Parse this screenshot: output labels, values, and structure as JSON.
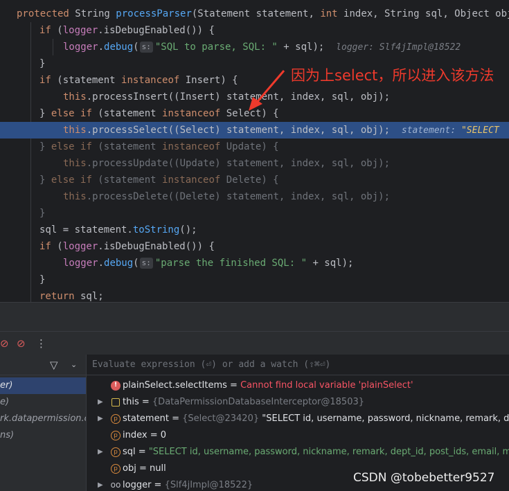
{
  "editor": {
    "line_signature": {
      "kw_protected": "protected",
      "type_string": " String ",
      "method_name": "processParser",
      "params": "(Statement statement, ",
      "kw_int": "int",
      "params_rest": " index, String sql, Object obj"
    },
    "line_if_debug": {
      "kw_if": "if",
      "open": " (",
      "field": "logger",
      "call": ".isDebugEnabled()) {"
    },
    "line_debug1": {
      "field": "logger",
      "dot": ".",
      "call": "debug",
      "open": "(",
      "chip": "s:",
      "string": "\"SQL to parse, SQL: \"",
      "rest": " + sql);",
      "hint": "logger: Slf4jImpl@18522"
    },
    "line_close1": "}",
    "line_if_insert": {
      "kw_if": "if",
      "open": " (statement ",
      "kw_instanceof": "instanceof",
      "rest": " Insert) {"
    },
    "line_process_insert": {
      "kw_this": "this",
      "call": ".processInsert((Insert) statement, index, sql, obj);"
    },
    "line_else_select": {
      "close": "} ",
      "kw_else": "else",
      "sp": " ",
      "kw_if": "if",
      "open": " (statement ",
      "kw_instanceof": "instanceof",
      "rest": " Select) {"
    },
    "line_process_select": {
      "kw_this": "this",
      "call": ".processSelect((Select) statement, index, sql, obj);",
      "hint_name": "statement: ",
      "hint_value": "\"SELECT"
    },
    "line_else_update": {
      "close": "} ",
      "kw_else": "else",
      "sp": " ",
      "kw_if": "if",
      "open": " (statement ",
      "kw_instanceof": "instanceof",
      "rest": " Update) {"
    },
    "line_process_update": {
      "kw_this": "this",
      "call": ".processUpdate((Update) statement, index, sql, obj);"
    },
    "line_else_delete": {
      "close": "} ",
      "kw_else": "else",
      "sp": " ",
      "kw_if": "if",
      "open": " (statement ",
      "kw_instanceof": "instanceof",
      "rest": " Delete) {"
    },
    "line_process_delete": {
      "kw_this": "this",
      "call": ".processDelete((Delete) statement, index, sql, obj);"
    },
    "line_close2": "}",
    "line_sql_assign": {
      "left": "sql = statement.",
      "call": "toString",
      "rest": "();"
    },
    "line_if_debug2": {
      "kw_if": "if",
      "open": " (",
      "field": "logger",
      "call": ".isDebugEnabled()) {"
    },
    "line_debug2": {
      "field": "logger",
      "dot": ".",
      "call": "debug",
      "open": "(",
      "chip": "s:",
      "string": "\"parse the finished SQL: \"",
      "rest": " + sql);"
    },
    "line_close3": "}",
    "line_return": {
      "kw_return": "return",
      "rest": " sql;"
    }
  },
  "annotation": {
    "text": "因为上select，所以进入该方法",
    "color": "#ef3a2c"
  },
  "debugger": {
    "evaluate_placeholder": "Evaluate expression (⏎) or add a watch (⇧⌘⏎)",
    "frames": [
      {
        "label": "er)",
        "selected": true
      },
      {
        "label": "e)",
        "selected": false
      },
      {
        "label": "rk.datapermission.co",
        "selected": false
      },
      {
        "label": "ns)",
        "selected": false
      }
    ],
    "variables": [
      {
        "icon": "error-icon",
        "expandable": false,
        "name": "plainSelect.selectItems",
        "eq": " = ",
        "type": "",
        "value": "Cannot find local variable 'plainSelect'",
        "value_kind": "error"
      },
      {
        "icon": "field-icon",
        "expandable": true,
        "name": "this",
        "eq": " = ",
        "type": "{DataPermissionDatabaseInterceptor@18503}",
        "value": "",
        "value_kind": "plain"
      },
      {
        "icon": "parameter-icon",
        "expandable": true,
        "name": "statement",
        "eq": " = ",
        "type": "{Select@23420}",
        "value": " \"SELECT id, username, password, nickname, remark, dept_id, p",
        "value_kind": "plain"
      },
      {
        "icon": "parameter-icon",
        "expandable": false,
        "name": "index",
        "eq": " = ",
        "type": "",
        "value": "0",
        "value_kind": "plain"
      },
      {
        "icon": "parameter-icon",
        "expandable": true,
        "name": "sql",
        "eq": " = ",
        "type": "",
        "value": "\"SELECT id, username, password, nickname, remark, dept_id, post_ids, email, mobile, s",
        "value_kind": "string"
      },
      {
        "icon": "parameter-icon",
        "expandable": false,
        "name": "obj",
        "eq": " = ",
        "type": "",
        "value": "null",
        "value_kind": "plain"
      },
      {
        "icon": "watch-icon",
        "expandable": true,
        "name": "logger",
        "eq": " = ",
        "type": "{Slf4jImpl@18522}",
        "value": "",
        "value_kind": "plain"
      }
    ]
  },
  "watermark": "CSDN @tobebetter9527"
}
